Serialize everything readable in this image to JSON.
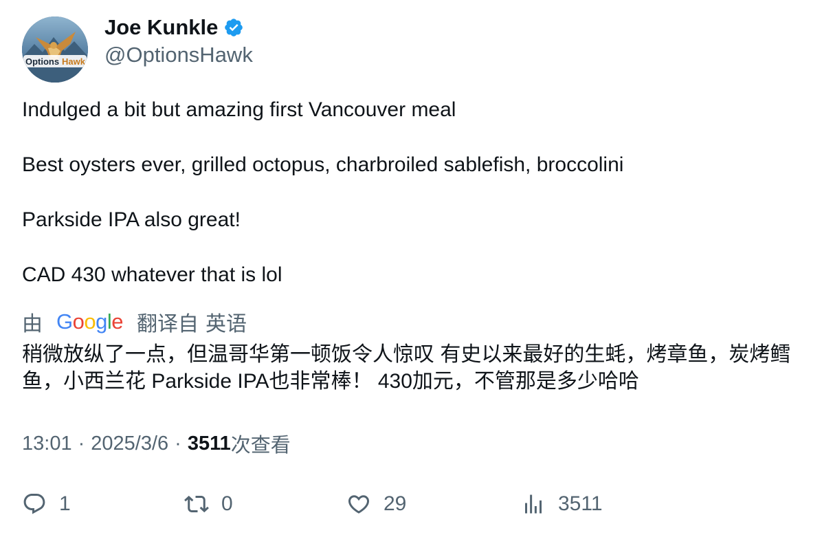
{
  "author": {
    "name": "Joe Kunkle",
    "handle": "@OptionsHawk",
    "avatar_label": "OptionsHawk",
    "verified_icon": "verified-badge-icon",
    "verified_color": "#1d9bf0"
  },
  "tweet": {
    "lines": [
      "Indulged a bit but amazing first Vancouver meal",
      "Best oysters ever, grilled octopus, charbroiled sablefish, broccolini",
      "Parkside IPA also great!",
      "CAD 430 whatever that is lol"
    ]
  },
  "translation": {
    "prefix": "由",
    "provider": "Google",
    "label": "翻译自",
    "language": "英语",
    "text": "稍微放纵了一点，但温哥华第一顿饭令人惊叹 有史以来最好的生蚝，烤章鱼，炭烤鳕鱼，小西兰花 Parkside IPA也非常棒！ 430加元，不管那是多少哈哈"
  },
  "meta": {
    "time": "13:01",
    "date": "2025/3/6",
    "views_count": "3511",
    "views_label": "次查看",
    "separator": "·"
  },
  "actions": {
    "reply": {
      "icon": "reply-icon",
      "count": "1"
    },
    "retweet": {
      "icon": "retweet-icon",
      "count": "0"
    },
    "like": {
      "icon": "heart-icon",
      "count": "29"
    },
    "views": {
      "icon": "analytics-icon",
      "count": "3511"
    }
  },
  "colors": {
    "text": "#0f1419",
    "secondary": "#536471",
    "accent": "#1d9bf0"
  }
}
